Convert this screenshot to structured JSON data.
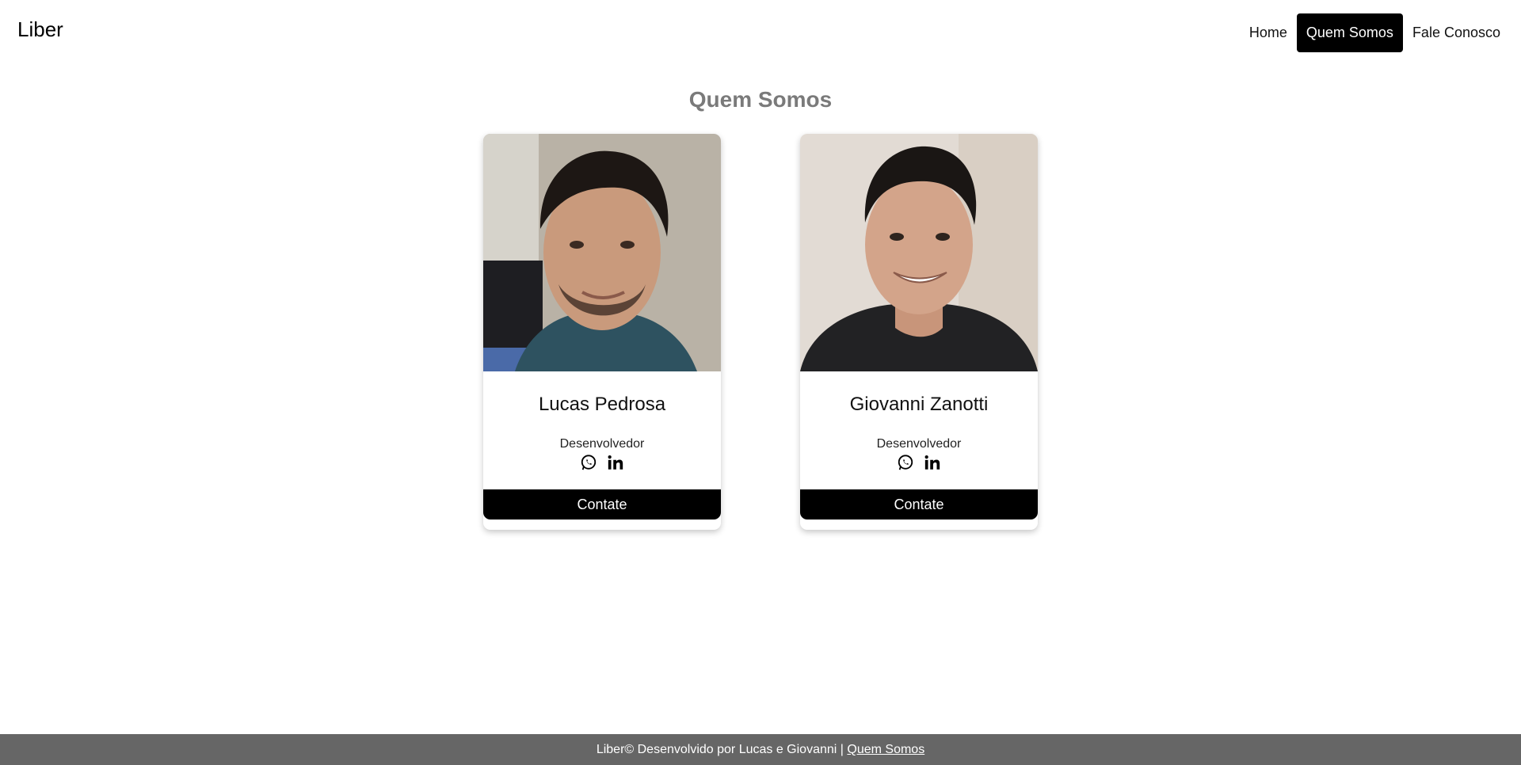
{
  "navbar": {
    "brand": "Liber",
    "links": [
      {
        "label": "Home",
        "active": false
      },
      {
        "label": "Quem Somos",
        "active": true
      },
      {
        "label": "Fale Conosco",
        "active": false
      }
    ]
  },
  "main": {
    "title": "Quem Somos",
    "cards": [
      {
        "name": "Lucas Pedrosa",
        "role": "Desenvolvedor",
        "socials": [
          "whatsapp-icon",
          "linkedin-icon"
        ],
        "button_label": "Contate"
      },
      {
        "name": "Giovanni Zanotti",
        "role": "Desenvolvedor",
        "socials": [
          "whatsapp-icon",
          "linkedin-icon"
        ],
        "button_label": "Contate"
      }
    ]
  },
  "footer": {
    "text": "Liber© Desenvolvido por Lucas e Giovanni | ",
    "link_label": "Quem Somos"
  },
  "colors": {
    "nav_active_bg": "#000000",
    "title_gray": "#7a7a7a",
    "footer_bg": "#666666",
    "button_bg": "#000000"
  }
}
